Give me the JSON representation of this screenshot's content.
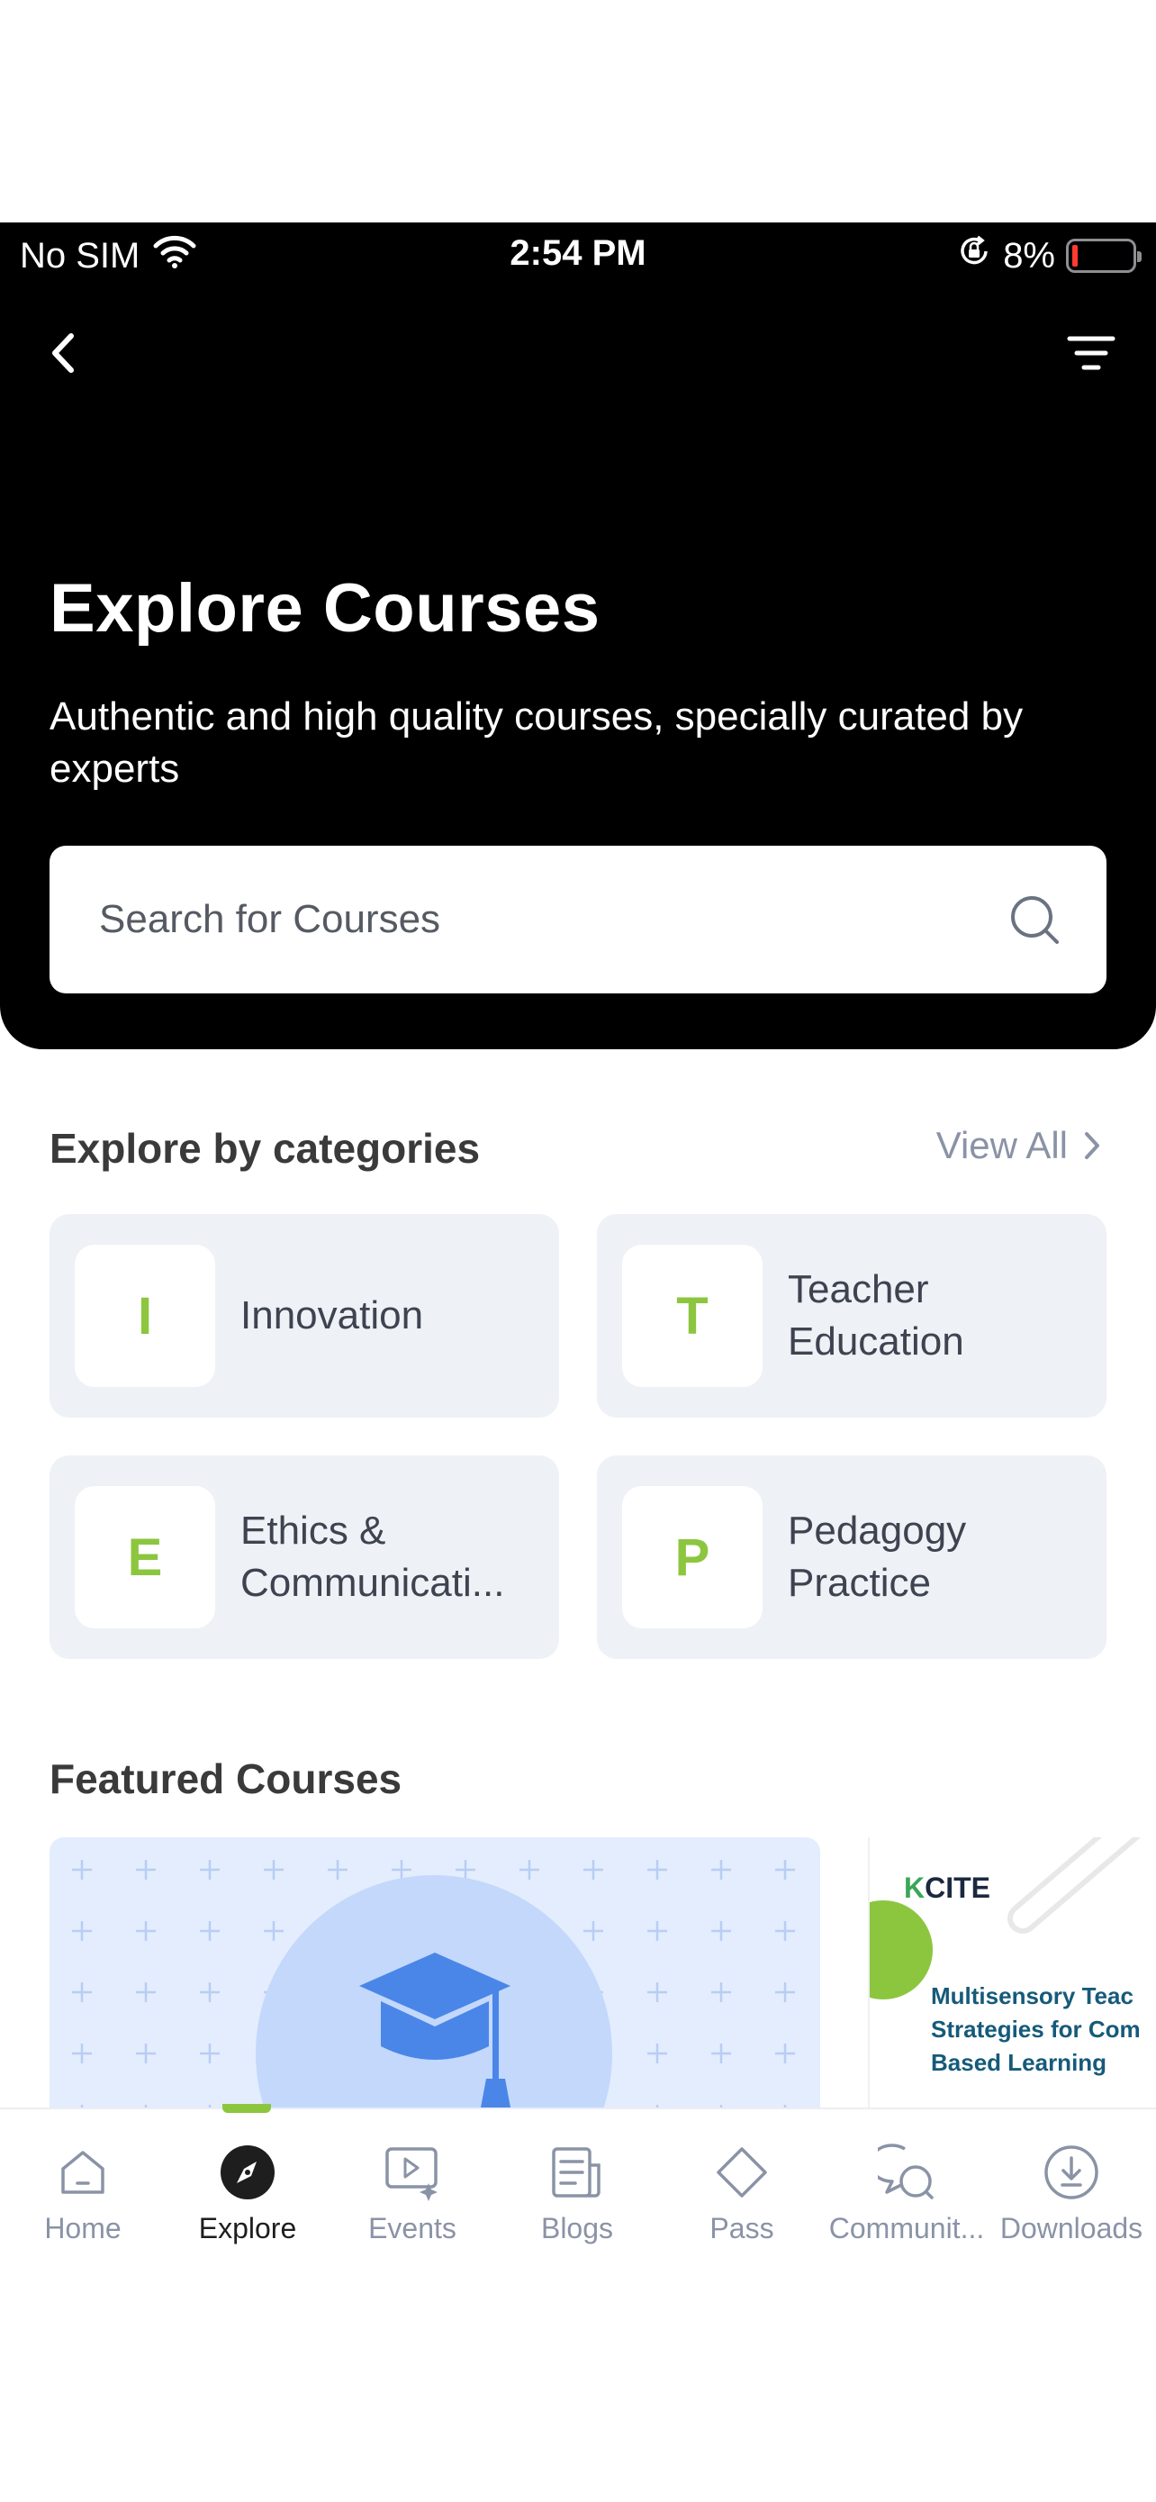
{
  "status_bar": {
    "carrier": "No SIM",
    "time": "2:54 PM",
    "battery_percent": "8%",
    "battery_level": 0.08,
    "icons": [
      "wifi-icon",
      "orientation-lock-icon",
      "battery-icon"
    ]
  },
  "header": {
    "back_icon": "chevron-left-icon",
    "filter_icon": "filter-icon",
    "title": "Explore Courses",
    "subtitle": "Authentic and high quality courses, specially curated by experts"
  },
  "search": {
    "placeholder": "Search for Courses",
    "value": "",
    "icon": "search-icon"
  },
  "categories": {
    "title": "Explore by categories",
    "view_all_label": "View All",
    "items": [
      {
        "badge": "I",
        "label": "Innovation"
      },
      {
        "badge": "T",
        "label": "Teacher Education"
      },
      {
        "badge": "E",
        "label": "Ethics & Communicati..."
      },
      {
        "badge": "P",
        "label": "Pedagogy Practice"
      }
    ]
  },
  "featured": {
    "title": "Featured Courses",
    "courses": [
      {
        "image_icon": "graduation-cap-icon"
      },
      {
        "logo_text": "KCITE",
        "title_lines": [
          "Multisensory Teac",
          "Strategies for Com",
          "Based Learning"
        ]
      }
    ]
  },
  "tabs": {
    "active": "Explore",
    "items": [
      {
        "label": "Home",
        "icon": "home-icon"
      },
      {
        "label": "Explore",
        "icon": "compass-icon"
      },
      {
        "label": "Events",
        "icon": "video-events-icon"
      },
      {
        "label": "Blogs",
        "icon": "blog-icon"
      },
      {
        "label": "Pass",
        "icon": "diamond-icon"
      },
      {
        "label": "Communit...",
        "icon": "community-chat-icon"
      },
      {
        "label": "Downloads",
        "icon": "download-icon"
      }
    ]
  },
  "colors": {
    "accent_green": "#8cc63f",
    "hero_bg": "#000000",
    "card_bg": "#eef1f6",
    "muted_text": "#8a93a6"
  }
}
